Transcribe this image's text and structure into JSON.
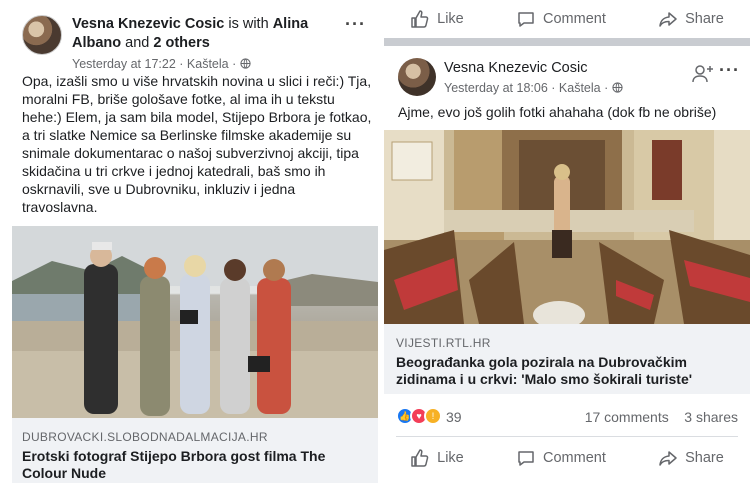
{
  "left_post": {
    "author": "Vesna Knezevic Cosic",
    "with_text": "is with",
    "tagged_name": "Alina Albano",
    "and_text": "and",
    "others": "2 others",
    "timestamp": "Yesterday at 17:22",
    "location": "Kaštela",
    "body": "Opa, izašli smo u više hrvatskih novina u slici i reči:) Tja, moralni FB, briše gološave fotke, al ima ih u tekstu hehe:) Elem, ja sam bila model, Stijepo Brbora je fotkao, a tri slatke Nemice sa Berlinske filmske akademije su snimale dokumentarac o našoj subverzivnoj akciji, tipa skidačina u tri crkve i jednoj katedrali, baš smo ih oskrnavili, sve u Dubrovniku, inkluziv i jedna travoslavna.",
    "link_domain": "DUBROVACKI.SLOBODNADALMACIJA.HR",
    "link_title": "Erotski fotograf Stijepo Brbora gost  filma The Colour Nude"
  },
  "right_post": {
    "top_actions": {
      "like": "Like",
      "comment": "Comment",
      "share": "Share"
    },
    "author": "Vesna Knezevic Cosic",
    "timestamp": "Yesterday at 18:06",
    "location": "Kaštela",
    "body": "Ajme, evo još golih fotki ahahaha (dok fb ne obriše)",
    "link_domain": "VIJESTI.RTL.HR",
    "link_title": "Beograđanka gola pozirala na Dubrovačkim zidinama i u crkvi: 'Malo smo šokirali turiste'",
    "reaction_count": "39",
    "comments": "17 comments",
    "shares": "3 shares",
    "bottom_actions": {
      "like": "Like",
      "comment": "Comment",
      "share": "Share"
    }
  },
  "icons": [
    "thumbs-up-icon",
    "comment-icon",
    "share-icon",
    "globe-icon",
    "more-icon",
    "add-friend-icon"
  ],
  "colors": {
    "link_bg": "#f0f2f5",
    "muted_text": "#65676b",
    "like_blue": "#1877f2",
    "love_red": "#f33e58",
    "wow_yellow": "#f7b125"
  }
}
